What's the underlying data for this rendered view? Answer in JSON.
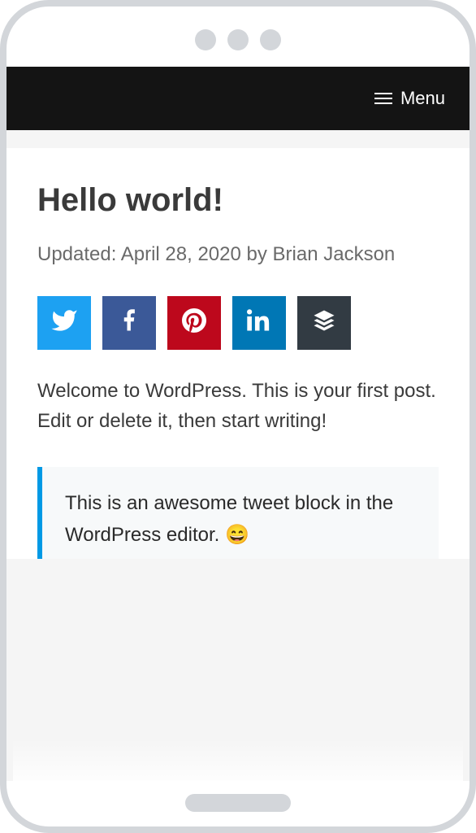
{
  "header": {
    "menu_label": "Menu"
  },
  "post": {
    "title": "Hello world!",
    "meta_text": "Updated: April 28, 2020 by Brian Jackson",
    "body": "Welcome to WordPress. This is your first post. Edit or delete it, then start writing!",
    "tweet_block": "This is an awesome tweet block in the WordPress editor. 😄"
  },
  "social": {
    "twitter": "twitter",
    "facebook": "facebook",
    "pinterest": "pinterest",
    "linkedin": "linkedin",
    "buffer": "buffer"
  }
}
